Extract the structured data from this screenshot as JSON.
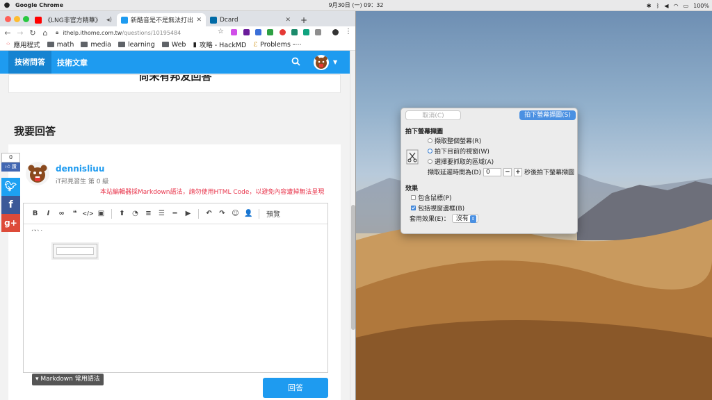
{
  "menubar": {
    "app_name": "Google Chrome",
    "clock": "9月30日 (一) 09：32",
    "battery": "100%"
  },
  "browser": {
    "tabs": [
      {
        "title": "《LNG非官方精華》",
        "active": false,
        "favicon_color": "#ff0000"
      },
      {
        "title": "新酷音是不是無法打出",
        "active": true,
        "favicon_color": "#1e9bf0"
      },
      {
        "title": "Dcard",
        "active": false,
        "favicon_color": "#006aa6"
      }
    ],
    "new_tab": "+",
    "url_host": "ithelp.ithome.com.tw",
    "url_path": "/questions/10195484",
    "bookmarks": [
      {
        "label": "應用程式",
        "icon": "apps-icon"
      },
      {
        "label": "math",
        "icon": "folder-icon"
      },
      {
        "label": "media",
        "icon": "folder-icon"
      },
      {
        "label": "learning",
        "icon": "folder-icon"
      },
      {
        "label": "Web",
        "icon": "folder-icon"
      },
      {
        "label": "攻略 - HackMD",
        "icon": "hackmd-icon"
      },
      {
        "label": "Problems -⋯",
        "icon": "problems-icon"
      }
    ]
  },
  "site": {
    "nav_questions": "技術問答",
    "nav_articles": "技術文章",
    "no_reply_text": "尚未有邦友回答",
    "answer_heading": "我要回答",
    "share_count": "0",
    "share_like": "讚",
    "share_buttons": [
      "t",
      "f",
      "g+"
    ],
    "username": "dennisliuu",
    "user_level": "iT邦見習生 第 0 級",
    "markdown_notice": "本站編輯器採Markdown語法，請勿使用HTML Code，以避免內容遭掉無法呈現",
    "toolbar": [
      "B",
      "I",
      "∞",
      "❝",
      "</>",
      "▣",
      "⬆",
      "◔",
      "≡",
      "☰",
      "━",
      "▶",
      "↶",
      "↷",
      "☺",
      "👤"
    ],
    "preview_label": "預覽",
    "editor_text": "ˊˇˋ˙",
    "markdown_tip": "▾ Markdown 常用語法",
    "submit_label": "回答"
  },
  "screenshot_dialog": {
    "cancel_label": "取消(C)",
    "shoot_label": "拍下螢幕擷圖(S)",
    "section_capture": "拍下螢幕擷圖",
    "options": [
      {
        "label": "擷取整個螢幕(R)",
        "selected": false
      },
      {
        "label": "拍下目前的視窗(W)",
        "selected": true
      },
      {
        "label": "選擇要抓取的區域(A)",
        "selected": false
      }
    ],
    "delay_prefix": "擷取延遲時間為(D)",
    "delay_value": "0",
    "delay_minus": "−",
    "delay_plus": "+",
    "delay_suffix": "秒後拍下螢幕擷圖",
    "section_effects": "效果",
    "include_pointer": {
      "label": "包含鼠標(P)",
      "checked": false
    },
    "include_border": {
      "label": "包括視窗邊框(B)",
      "checked": true
    },
    "apply_effect_label": "套用效果(E)：",
    "apply_effect_value": "沒有"
  },
  "colors": {
    "site_blue": "#1e9bf0",
    "site_blue_dark": "#1583d1",
    "notice_red": "#e8334a",
    "dialog_accent": "#4a90e2"
  }
}
